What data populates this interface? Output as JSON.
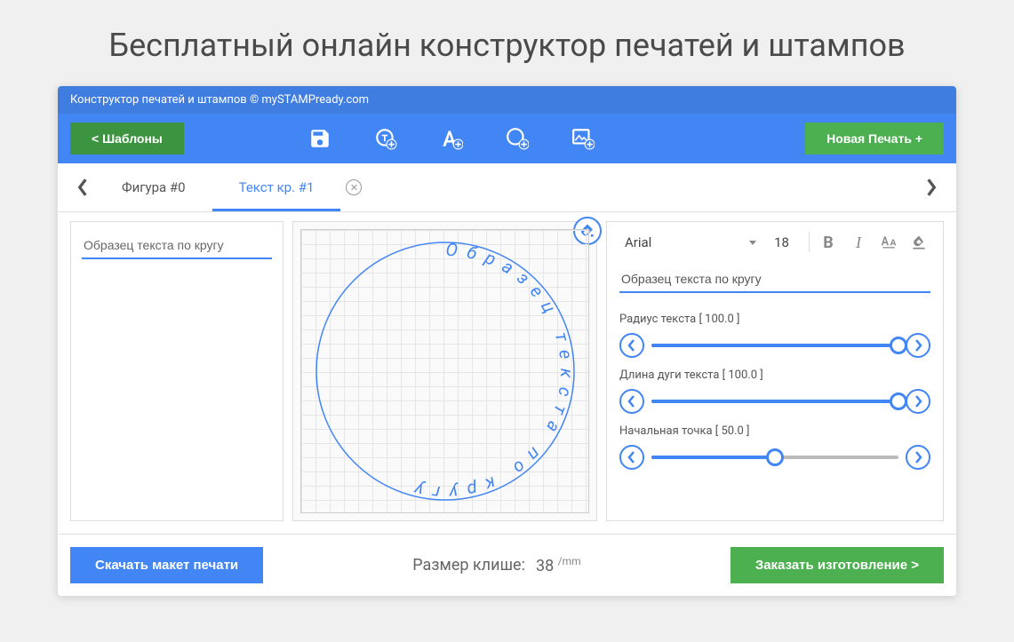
{
  "page_title": "Бесплатный онлайн конструктор печатей и штампов",
  "titlebar": "Конструктор печатей и штампов © mySTAMPready.com",
  "toolbar": {
    "templates": "<   Шаблоны",
    "new_stamp": "Новая Печать +"
  },
  "tabs": {
    "shape": "Фигура #0",
    "text_circle": "Текст кр. #1"
  },
  "left_panel": {
    "sample_text": "Образец текста по кругу"
  },
  "canvas_text": "Образец текста по кругу",
  "right_panel": {
    "font": "Arial",
    "size": "18",
    "sample_text": "Образец текста по кругу",
    "radius_label": "Радиус текста [ 100.0 ]",
    "arc_label": "Длина дуги текста [ 100.0 ]",
    "start_label": "Начальная точка [ 50.0 ]",
    "radius_value": 100.0,
    "arc_value": 100.0,
    "start_value": 50.0
  },
  "bottom": {
    "download": "Скачать макет печати",
    "size_label": "Размер клише:",
    "size_value": "38",
    "size_unit": "/mm",
    "order": "Заказать изготовление >"
  }
}
